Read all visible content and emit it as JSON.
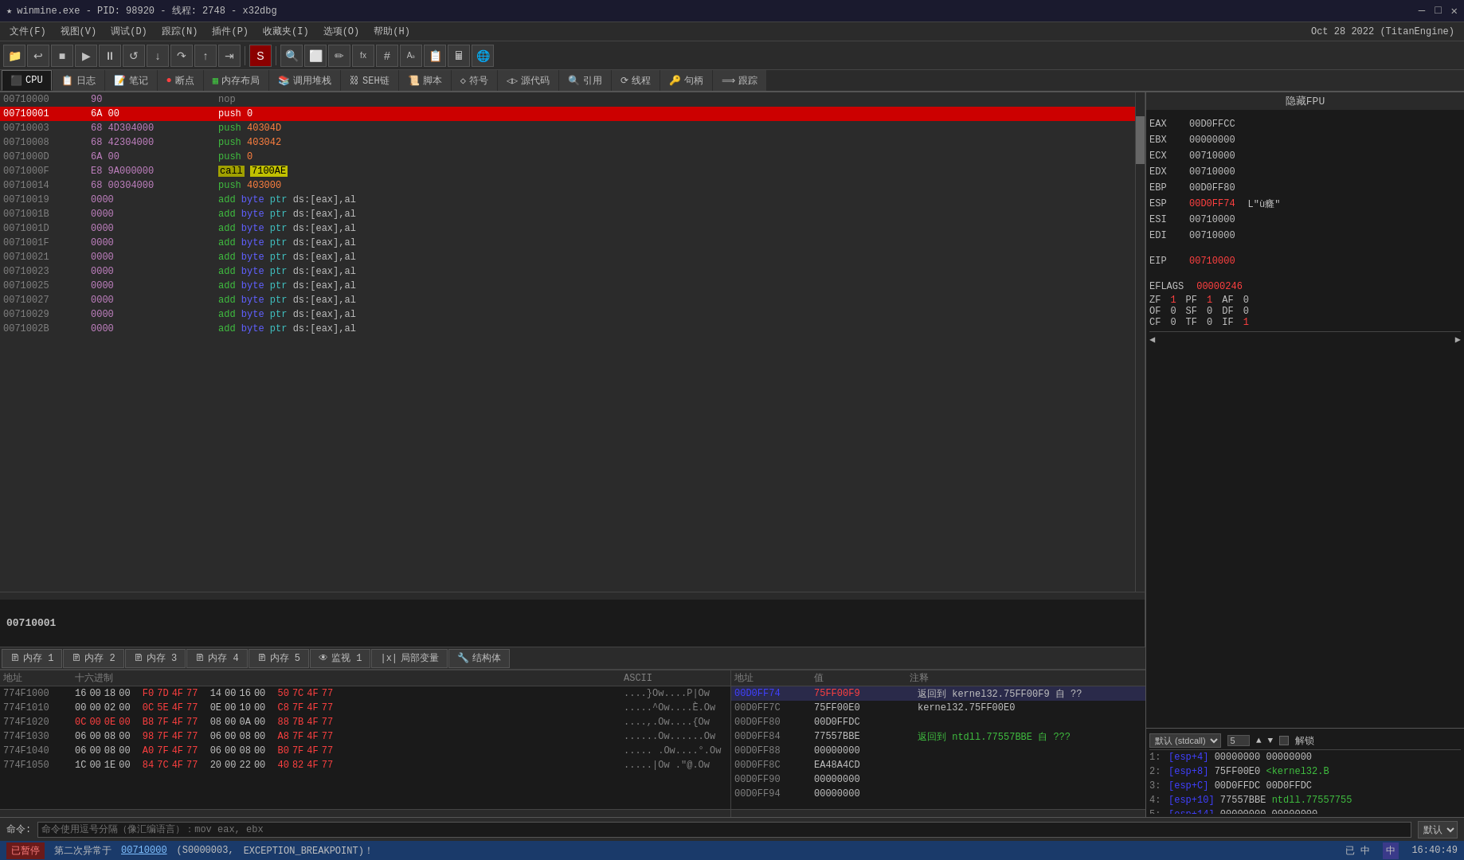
{
  "titleBar": {
    "title": "winmine.exe - PID: 98920 - 线程: 2748 - x32dbg",
    "icon": "★",
    "btnMin": "—",
    "btnMax": "□",
    "btnClose": "✕"
  },
  "menuBar": {
    "items": [
      {
        "label": "文件(F)"
      },
      {
        "label": "视图(V)"
      },
      {
        "label": "调试(D)"
      },
      {
        "label": "跟踪(N)"
      },
      {
        "label": "插件(P)"
      },
      {
        "label": "收藏夹(I)"
      },
      {
        "label": "选项(O)"
      },
      {
        "label": "帮助(H)"
      }
    ],
    "date": "Oct 28 2022 (TitanEngine)"
  },
  "tabs": [
    {
      "label": "CPU",
      "icon": "⬛",
      "active": true
    },
    {
      "label": "日志",
      "icon": "📋"
    },
    {
      "label": "笔记",
      "icon": "📝"
    },
    {
      "label": "断点",
      "icon": "●"
    },
    {
      "label": "内存布局",
      "icon": "▦"
    },
    {
      "label": "调用堆栈",
      "icon": "📚"
    },
    {
      "label": "SEH链",
      "icon": "⛓"
    },
    {
      "label": "脚本",
      "icon": "📜"
    },
    {
      "label": "符号",
      "icon": "◇"
    },
    {
      "label": "源代码",
      "icon": "◁▷"
    },
    {
      "label": "引用",
      "icon": "🔍"
    },
    {
      "label": "线程",
      "icon": "⟳"
    },
    {
      "label": "句柄",
      "icon": "🔑"
    },
    {
      "label": "跟踪",
      "icon": "⟹"
    }
  ],
  "fpuTitle": "隐藏FPU",
  "registers": {
    "EAX": {
      "name": "EAX",
      "val": "00D0FFCC",
      "changed": false
    },
    "EBX": {
      "name": "EBX",
      "val": "00000000",
      "changed": false
    },
    "ECX": {
      "name": "ECX",
      "val": "00710000",
      "changed": false
    },
    "EDX": {
      "name": "EDX",
      "val": "00710000",
      "changed": false
    },
    "EBP": {
      "name": "EBP",
      "val": "00D0FF80",
      "changed": false
    },
    "ESP": {
      "name": "ESP",
      "val": "00D0FF74",
      "changed": true,
      "comment": "L\"ù癃\""
    },
    "ESI": {
      "name": "ESI",
      "val": "00710000",
      "changed": false
    },
    "EDI": {
      "name": "EDI",
      "val": "00710000",
      "changed": false
    },
    "EIP": {
      "name": "EIP",
      "val": "00710000",
      "changed": true
    }
  },
  "eflags": {
    "label": "EFLAGS",
    "val": "00000246",
    "flags": [
      {
        "name": "ZF",
        "val": "1"
      },
      {
        "name": "PF",
        "val": "1"
      },
      {
        "name": "AF",
        "val": "0"
      },
      {
        "name": "OF",
        "val": "0"
      },
      {
        "name": "SF",
        "val": "0"
      },
      {
        "name": "DF",
        "val": "0"
      },
      {
        "name": "CF",
        "val": "0"
      },
      {
        "name": "TF",
        "val": "0"
      },
      {
        "name": "IF",
        "val": "1"
      }
    ]
  },
  "callStack": {
    "convention": "默认 (stdcall)",
    "count": "5",
    "rows": [
      {
        "idx": "1:",
        "content": "[esp+4]  00000000 00000000"
      },
      {
        "idx": "2:",
        "content": "[esp+8]  75FF00E0 <kernel32.B"
      },
      {
        "idx": "3:",
        "content": "[esp+C]  00D0FFDC 00D0FFDC"
      },
      {
        "idx": "4:",
        "content": "[esp+10] 77557BBE ntdll.77557755"
      },
      {
        "idx": "5:",
        "content": "[esp+14] 00000000 00000000"
      }
    ]
  },
  "disassembly": [
    {
      "addr": "00710000",
      "bytes": "90",
      "instr": "nop",
      "current": false,
      "selected": false
    },
    {
      "addr": "00710001",
      "bytes": "6A 00",
      "instr": "push 0",
      "current": true,
      "selected": false
    },
    {
      "addr": "00710003",
      "bytes": "68 4D304000",
      "instr": "push 40304D",
      "current": false
    },
    {
      "addr": "00710008",
      "bytes": "68 42304000",
      "instr": "push 403042",
      "current": false
    },
    {
      "addr": "0071000D",
      "bytes": "6A 00",
      "instr": "push 0",
      "current": false
    },
    {
      "addr": "0071000F",
      "bytes": "E8 9A000000",
      "instr": "call 7100AE",
      "current": false,
      "isCall": true
    },
    {
      "addr": "00710014",
      "bytes": "68 00304000",
      "instr": "push 403000",
      "current": false
    },
    {
      "addr": "00710019",
      "bytes": "0000",
      "instr": "add byte ptr ds:[eax],al",
      "current": false
    },
    {
      "addr": "0071001B",
      "bytes": "0000",
      "instr": "add byte ptr ds:[eax],al",
      "current": false
    },
    {
      "addr": "0071001D",
      "bytes": "0000",
      "instr": "add byte ptr ds:[eax],al",
      "current": false
    },
    {
      "addr": "0071001F",
      "bytes": "0000",
      "instr": "add byte ptr ds:[eax],al",
      "current": false
    },
    {
      "addr": "00710021",
      "bytes": "0000",
      "instr": "add byte ptr ds:[eax],al",
      "current": false
    },
    {
      "addr": "00710023",
      "bytes": "0000",
      "instr": "add byte ptr ds:[eax],al",
      "current": false
    },
    {
      "addr": "00710025",
      "bytes": "0000",
      "instr": "add byte ptr ds:[eax],al",
      "current": false
    },
    {
      "addr": "00710027",
      "bytes": "0000",
      "instr": "add byte ptr ds:[eax],al",
      "current": false
    },
    {
      "addr": "00710029",
      "bytes": "0000",
      "instr": "add byte ptr ds:[eax],al",
      "current": false
    },
    {
      "addr": "0071002B",
      "bytes": "0000",
      "instr": "add byte ptr ds:[eax],al",
      "current": false
    }
  ],
  "infoArea": {
    "addr": "00710001"
  },
  "memTabs": [
    {
      "label": "内存 1",
      "active": false
    },
    {
      "label": "内存 2",
      "active": false
    },
    {
      "label": "内存 3",
      "active": false
    },
    {
      "label": "内存 4",
      "active": false
    },
    {
      "label": "内存 5",
      "active": false
    },
    {
      "label": "监视 1",
      "active": false
    },
    {
      "label": "局部变量",
      "active": false
    },
    {
      "label": "结构体",
      "active": false
    }
  ],
  "memPanel": {
    "columns": [
      "地址",
      "十六进制",
      "ASCII"
    ],
    "rows": [
      {
        "addr": "774F1000",
        "hex": [
          "16",
          "00",
          "18",
          "00",
          "F0",
          "7D",
          "4F",
          "77",
          "14",
          "00",
          "16",
          "00",
          "50",
          "7C",
          "4F",
          "77"
        ],
        "ascii": "....}Ow....P|Ow"
      },
      {
        "addr": "774F1010",
        "hex": [
          "00",
          "00",
          "02",
          "00",
          "0C",
          "5E",
          "4F",
          "77",
          "0E",
          "00",
          "10",
          "00",
          "C8",
          "7F",
          "4F",
          "77"
        ],
        "ascii": ".....^Ow....È.Ow"
      },
      {
        "addr": "774F1020",
        "hex": [
          "0C",
          "00",
          "0E",
          "00",
          "B8",
          "7F",
          "4F",
          "77",
          "08",
          "00",
          "0A",
          "00",
          "88",
          "7B",
          "4F",
          "77"
        ],
        "ascii": ".....Ow....{Ow"
      },
      {
        "addr": "774F1030",
        "hex": [
          "06",
          "00",
          "08",
          "00",
          "98",
          "7F",
          "4F",
          "77",
          "06",
          "00",
          "08",
          "00",
          "A8",
          "7F",
          "4F",
          "77"
        ],
        "ascii": "......Ow......Ow"
      },
      {
        "addr": "774F1040",
        "hex": [
          "06",
          "00",
          "08",
          "00",
          "A0",
          "7F",
          "4F",
          "77",
          "06",
          "00",
          "08",
          "00",
          "B0",
          "7F",
          "4F",
          "77"
        ],
        "ascii": "..... .Ow....°.Ow"
      },
      {
        "addr": "774F1050",
        "hex": [
          "1C",
          "00",
          "1E",
          "00",
          "84",
          "7C",
          "4F",
          "77",
          "20",
          "00",
          "22",
          "00",
          "40",
          "82",
          "4F",
          "77"
        ],
        "ascii": ".....|Ow .\"@.Ow"
      }
    ]
  },
  "stackAddrPanel": {
    "rows": [
      {
        "addr": "00D0FF74",
        "val": "75FF00F9",
        "comment": "返回到 kernel32.75FF00F9 自 ??",
        "selected": true,
        "addrColor": "blue"
      },
      {
        "addr": "00D0FF7C",
        "val": "75FF00E0",
        "comment": "kernel32.75FF00E0",
        "selected": false
      },
      {
        "addr": "00D0FF80",
        "val": "00D0FFDC",
        "comment": "",
        "selected": false
      },
      {
        "addr": "00D0FF84",
        "val": "77557BBE",
        "comment": "返回到 ntdll.77557BBE 自 ???",
        "selected": false,
        "commentColor": "green"
      },
      {
        "addr": "00D0FF88",
        "val": "00000000",
        "comment": "",
        "selected": false
      },
      {
        "addr": "00D0FF8C",
        "val": "EA48A4CD",
        "comment": "",
        "selected": false
      },
      {
        "addr": "00D0FF90",
        "val": "00000000",
        "comment": "",
        "selected": false
      },
      {
        "addr": "00D0FF94",
        "val": "00000000",
        "comment": "",
        "selected": false
      }
    ]
  },
  "commandBar": {
    "label": "命令:",
    "placeholder": "命令使用逗号分隔（像汇编语言）：mov eax, ebx",
    "defaultBtn": "默认"
  },
  "statusBar": {
    "paused": "已暂停",
    "text": "第二次异常于",
    "addr": "00710000",
    "addrExtra": "(S0000003,",
    "exception": "EXCEPTION_BREAKPOINT)！",
    "lang": "中",
    "ime": "中",
    "time": "16:40:49"
  }
}
